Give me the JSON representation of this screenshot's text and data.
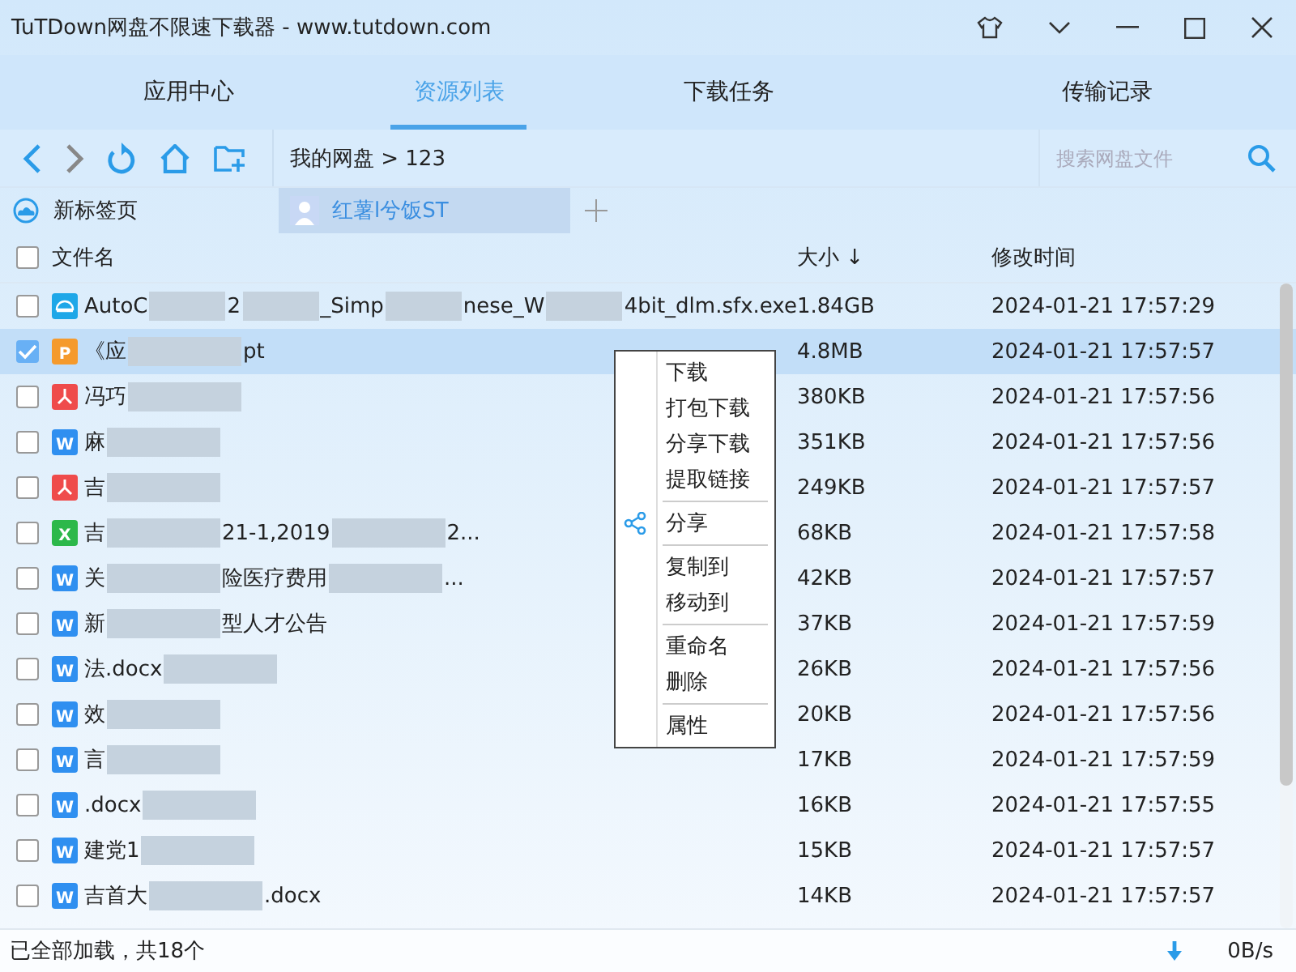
{
  "window": {
    "title": "TuTDown网盘不限速下载器 - www.tutdown.com"
  },
  "nav_tabs": [
    {
      "label": "应用中心",
      "selected": false
    },
    {
      "label": "资源列表",
      "selected": true
    },
    {
      "label": "下载任务",
      "selected": false
    },
    {
      "label": "传输记录",
      "selected": false
    }
  ],
  "breadcrumb": "我的网盘 > 123",
  "search": {
    "placeholder": "搜索网盘文件"
  },
  "page_tabs": [
    {
      "label": "新标签页",
      "kind": "cloud",
      "selected": false
    },
    {
      "label": "红薯l兮饭ST",
      "kind": "user",
      "selected": true
    }
  ],
  "table": {
    "columns": [
      "文件名",
      "大小 ↓",
      "修改时间"
    ],
    "select_all_checked": false,
    "rows": [
      {
        "kind": "exe",
        "name_parts": [
          "AutoC",
          "2",
          "_Simp",
          "nese_W",
          "4bit_dlm.sfx.exe"
        ],
        "size": "1.84GB",
        "modified": "2024-01-21 17:57:29",
        "checked": false
      },
      {
        "kind": "ppt",
        "badge": "P",
        "name_parts": [
          "《应",
          "pt"
        ],
        "size": "4.8MB",
        "modified": "2024-01-21 17:57:57",
        "checked": true
      },
      {
        "kind": "pdf",
        "name_parts": [
          "冯巧"
        ],
        "size": "380KB",
        "modified": "2024-01-21 17:57:56",
        "checked": false
      },
      {
        "kind": "word",
        "badge": "W",
        "name_parts": [
          "麻"
        ],
        "size": "351KB",
        "modified": "2024-01-21 17:57:56",
        "checked": false
      },
      {
        "kind": "pdf",
        "name_parts": [
          "吉"
        ],
        "size": "249KB",
        "modified": "2024-01-21 17:57:57",
        "checked": false
      },
      {
        "kind": "excel",
        "badge": "X",
        "name_parts": [
          "吉",
          "21-1,2019",
          "2..."
        ],
        "size": "68KB",
        "modified": "2024-01-21 17:57:58",
        "checked": false
      },
      {
        "kind": "word",
        "badge": "W",
        "name_parts": [
          "关",
          "险医疗费用",
          "..."
        ],
        "size": "42KB",
        "modified": "2024-01-21 17:57:57",
        "checked": false
      },
      {
        "kind": "word",
        "badge": "W",
        "name_parts": [
          "新",
          "型人才公告"
        ],
        "size": "37KB",
        "modified": "2024-01-21 17:57:59",
        "checked": false
      },
      {
        "kind": "word",
        "badge": "W",
        "name_parts": [
          "法.docx"
        ],
        "size": "26KB",
        "modified": "2024-01-21 17:57:56",
        "checked": false
      },
      {
        "kind": "word",
        "badge": "W",
        "name_parts": [
          "效"
        ],
        "size": "20KB",
        "modified": "2024-01-21 17:57:56",
        "checked": false
      },
      {
        "kind": "word",
        "badge": "W",
        "name_parts": [
          "言"
        ],
        "size": "17KB",
        "modified": "2024-01-21 17:57:59",
        "checked": false
      },
      {
        "kind": "word",
        "badge": "W",
        "name_parts": [
          ".docx"
        ],
        "size": "16KB",
        "modified": "2024-01-21 17:57:55",
        "checked": false
      },
      {
        "kind": "word",
        "badge": "W",
        "name_parts": [
          "建党1"
        ],
        "size": "15KB",
        "modified": "2024-01-21 17:57:57",
        "checked": false
      },
      {
        "kind": "word",
        "badge": "W",
        "name_parts": [
          "吉首大",
          ".docx"
        ],
        "size": "14KB",
        "modified": "2024-01-21 17:57:57",
        "checked": false
      }
    ]
  },
  "context_menu": [
    [
      {
        "label": "下载",
        "share_icon": false
      },
      {
        "label": "打包下载",
        "share_icon": false
      },
      {
        "label": "分享下载",
        "share_icon": false
      },
      {
        "label": "提取链接",
        "share_icon": false
      }
    ],
    [
      {
        "label": "分享",
        "share_icon": true
      }
    ],
    [
      {
        "label": "复制到",
        "share_icon": false
      },
      {
        "label": "移动到",
        "share_icon": false
      }
    ],
    [
      {
        "label": "重命名",
        "share_icon": false
      },
      {
        "label": "删除",
        "share_icon": false
      }
    ],
    [
      {
        "label": "属性",
        "share_icon": false
      }
    ]
  ],
  "status_bar": {
    "summary": "已全部加载，共18个",
    "speed": "0B/s"
  }
}
